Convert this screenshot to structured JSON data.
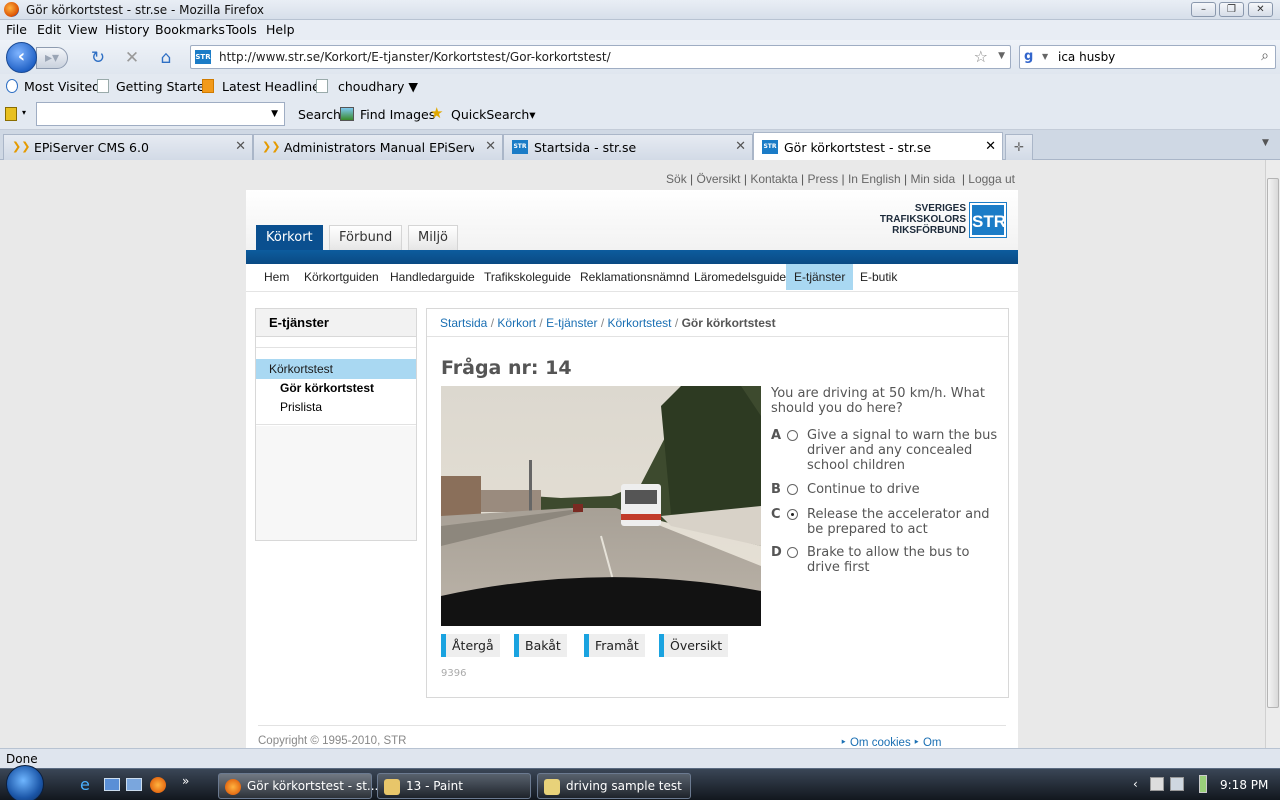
{
  "window": {
    "title": "Gör körkortstest - str.se - Mozilla Firefox"
  },
  "menu": [
    "File",
    "Edit",
    "View",
    "History",
    "Bookmarks",
    "Tools",
    "Help"
  ],
  "nav": {
    "url": "http://www.str.se/Korkort/E-tjanster/Korkortstest/Gor-korkortstest/",
    "search_value": "ica husby"
  },
  "bookmarks": [
    "Most Visited",
    "Getting Started",
    "Latest Headlines",
    "choudhary ▼"
  ],
  "ext_toolbar": {
    "search": "Search",
    "find_images": "Find Images",
    "quicksearch": "QuickSearch▾"
  },
  "tabs": [
    {
      "label": "EPiServer CMS 6.0"
    },
    {
      "label": "Administrators Manual EPiServer C..."
    },
    {
      "label": "Startsida - str.se"
    },
    {
      "label": "Gör körkortstest - str.se",
      "active": true
    }
  ],
  "page": {
    "toplinks": [
      "Sök",
      "Översikt",
      "Kontakta",
      "Press",
      "In English",
      "Min sida",
      "Logga ut"
    ],
    "logo": {
      "line1": "SVERIGES",
      "line2": "TRAFIKSKOLORS",
      "line3": "RIKSFÖRBUND",
      "box": "STR"
    },
    "main_tabs": [
      "Körkort",
      "Förbund",
      "Miljö"
    ],
    "subnav": [
      "Hem",
      "Körkortguiden",
      "Handledarguide",
      "Trafikskoleguide",
      "Reklamationsnämnd",
      "Läromedelsguide",
      "E-tjänster",
      "E-butik"
    ],
    "sidebar": {
      "heading": "E-tjänster",
      "selected": "Körkortstest",
      "sub1": "Gör körkortstest",
      "sub2": "Prislista"
    },
    "breadcrumb": [
      "Startsida",
      "Körkort",
      "E-tjänster",
      "Körkortstest"
    ],
    "breadcrumb_current": "Gör körkortstest",
    "question": {
      "title": "Fråga nr: 14",
      "text": "You are driving at 50 km/h. What should you do here?",
      "answers": [
        {
          "letter": "A",
          "text": "Give a signal to warn the bus driver and any concealed school children",
          "selected": false
        },
        {
          "letter": "B",
          "text": "Continue to drive",
          "selected": false
        },
        {
          "letter": "C",
          "text": "Release the accelerator and be prepared to act",
          "selected": true
        },
        {
          "letter": "D",
          "text": "Brake to allow the bus to drive first",
          "selected": false
        }
      ],
      "buttons": [
        "Återgå",
        "Bakåt",
        "Framåt",
        "Översikt"
      ],
      "id": "9396"
    },
    "footer": {
      "copyright": "Copyright © 1995-2010, STR",
      "links": [
        "Om cookies",
        "Om webbplatsen"
      ]
    }
  },
  "status": "Done",
  "taskbar": {
    "items": [
      "Gör körkortstest - st...",
      "13 - Paint",
      "driving sample test"
    ],
    "clock": "9:18 PM"
  }
}
